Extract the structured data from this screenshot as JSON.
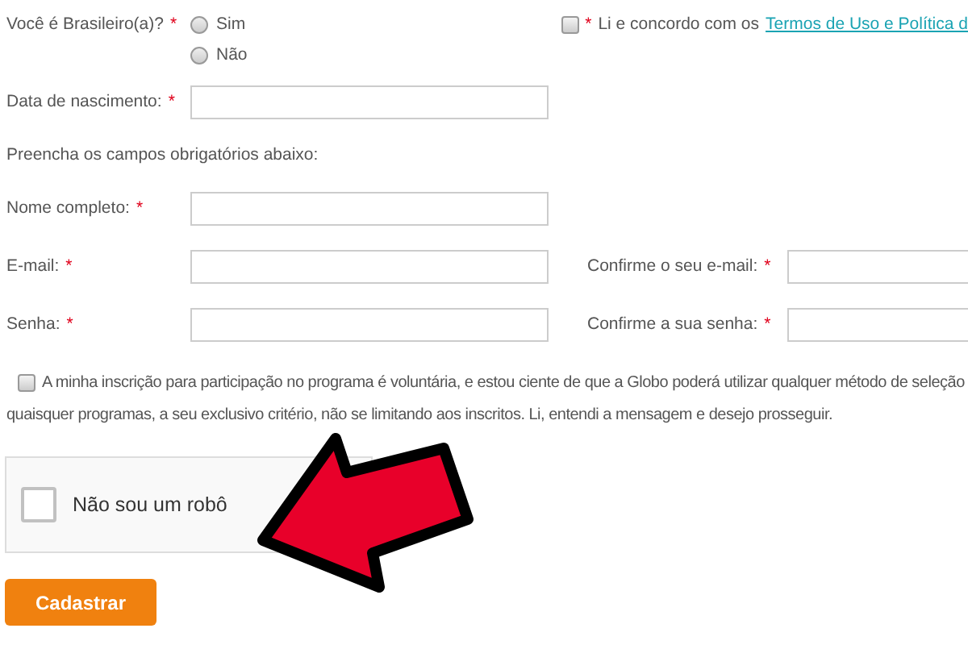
{
  "required_mark": "*",
  "nationality": {
    "label": "Você é Brasileiro(a)?",
    "required": true,
    "options": [
      {
        "label": "Sim",
        "selected": false
      },
      {
        "label": "Não",
        "selected": false
      }
    ]
  },
  "terms": {
    "checked": false,
    "required": true,
    "text": "Li e concordo com os",
    "link": "Termos de Uso e Política d"
  },
  "birth_date": {
    "label": "Data de nascimento:",
    "required": true
  },
  "instructions": "Preencha os campos obrigatórios abaixo:",
  "rows": [
    {
      "fields": [
        {
          "label": "Nome completo:",
          "required": true
        }
      ]
    },
    {
      "fields": [
        {
          "label": "E-mail:",
          "required": true
        },
        {
          "label": "Confirme o seu e-mail:",
          "required": true
        }
      ]
    },
    {
      "fields": [
        {
          "label": "Senha:",
          "required": true
        },
        {
          "label": "Confirme a sua senha:",
          "required": true
        }
      ]
    }
  ],
  "consent": {
    "checked": false,
    "lines": [
      "A minha inscrição para participação no programa é voluntária, e estou ciente de que a Globo poderá utilizar qualquer método de seleção",
      "quaisquer programas, a seu exclusivo critério, não se limitando aos inscritos. Li, entendi a mensagem e desejo prosseguir."
    ]
  },
  "captcha": {
    "checked": false,
    "label": "Não sou um robô"
  },
  "submit": "Cadastrar"
}
